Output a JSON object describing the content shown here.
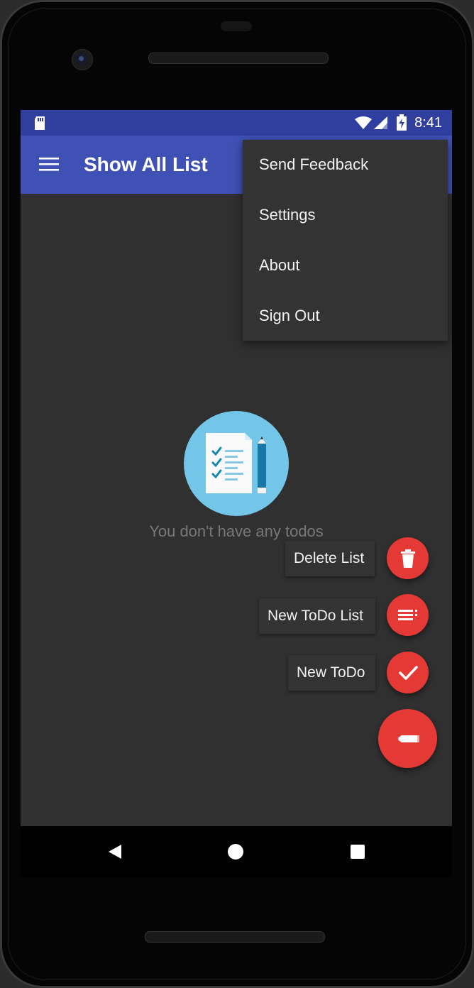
{
  "status_bar": {
    "time": "8:41",
    "icons": [
      "sd-card-icon",
      "wifi-icon",
      "signal-icon",
      "battery-charging-icon"
    ]
  },
  "app_bar": {
    "title": "Show All List",
    "menu_icon": "hamburger-menu-icon"
  },
  "overflow_menu": {
    "items": [
      {
        "label": "Send Feedback"
      },
      {
        "label": "Settings"
      },
      {
        "label": "About"
      },
      {
        "label": "Sign Out"
      }
    ]
  },
  "empty_state": {
    "icon": "checklist-with-pencil-icon",
    "message": "You don't have any todos"
  },
  "fab_menu": {
    "actions": [
      {
        "label": "Delete List",
        "icon": "trash-icon"
      },
      {
        "label": "New ToDo List",
        "icon": "list-icon"
      },
      {
        "label": "New ToDo",
        "icon": "check-icon"
      }
    ],
    "main_icon": "pencil-icon"
  },
  "navigation": {
    "buttons": [
      "back-icon",
      "home-icon",
      "recents-icon"
    ]
  },
  "colors": {
    "primary": "#3f51b5",
    "primary_dark": "#303f9f",
    "accent": "#e53935",
    "background": "#303030"
  }
}
